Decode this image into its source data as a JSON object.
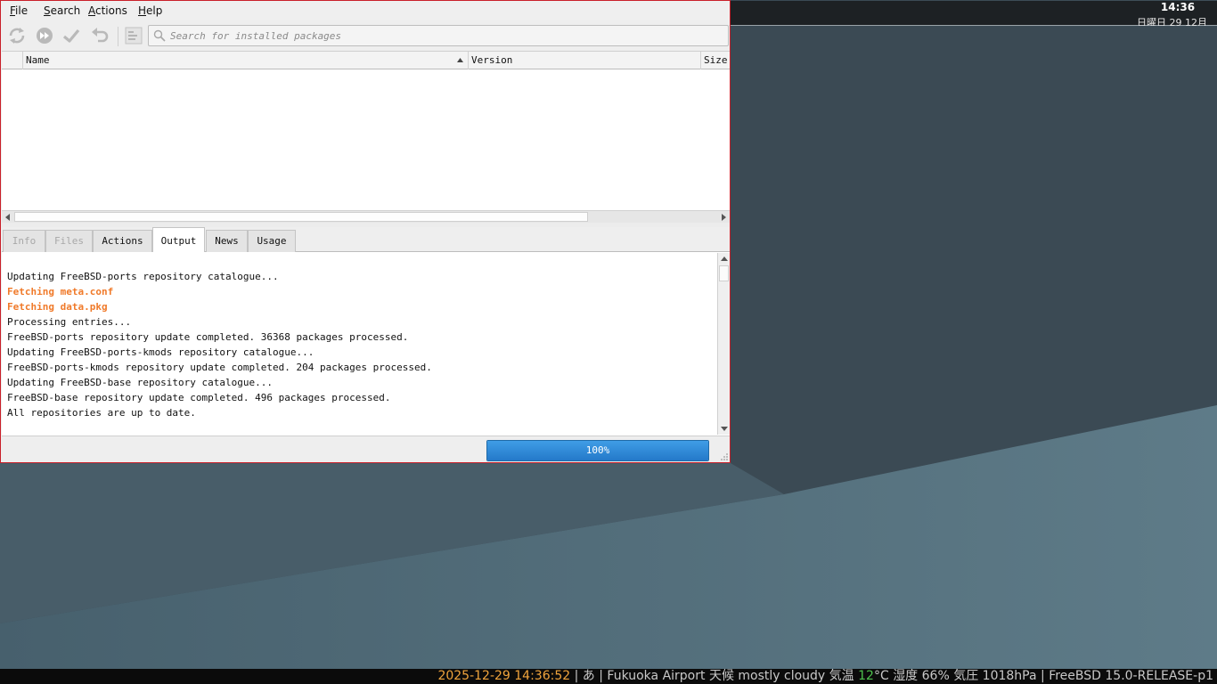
{
  "app": {
    "menu": [
      "File",
      "Search",
      "Actions",
      "Help"
    ],
    "menu_mnemonics": [
      "F",
      "S",
      "A",
      "H"
    ],
    "search": {
      "placeholder": "Search for installed packages",
      "value": ""
    },
    "toolbar_icons": [
      "refresh-icon",
      "fast-forward-icon",
      "checkmark-icon",
      "undo-icon",
      "list-icon"
    ],
    "table": {
      "columns": [
        "Name",
        "Version",
        "Size"
      ],
      "sorted_by": "Name",
      "rows": []
    },
    "tabs": [
      {
        "label": "Info",
        "state": "disabled"
      },
      {
        "label": "Files",
        "state": "disabled"
      },
      {
        "label": "Actions",
        "state": "normal"
      },
      {
        "label": "Output",
        "state": "active"
      },
      {
        "label": "News",
        "state": "normal"
      },
      {
        "label": "Usage",
        "state": "normal"
      }
    ],
    "output_lines": [
      {
        "text": "Updating FreeBSD-ports repository catalogue...",
        "highlight": false
      },
      {
        "text": "Fetching meta.conf",
        "highlight": true
      },
      {
        "text": "Fetching data.pkg",
        "highlight": true
      },
      {
        "text": "Processing entries...",
        "highlight": false
      },
      {
        "text": "FreeBSD-ports repository update completed. 36368 packages processed.",
        "highlight": false
      },
      {
        "text": "Updating FreeBSD-ports-kmods repository catalogue...",
        "highlight": false
      },
      {
        "text": "FreeBSD-ports-kmods repository update completed. 204 packages processed.",
        "highlight": false
      },
      {
        "text": "Updating FreeBSD-base repository catalogue...",
        "highlight": false
      },
      {
        "text": "FreeBSD-base repository update completed. 496 packages processed.",
        "highlight": false
      },
      {
        "text": "All repositories are up to date.",
        "highlight": false
      }
    ],
    "progress": {
      "label": "100%",
      "value": 1.0
    }
  },
  "panel": {
    "clock_time": "14:36",
    "clock_date": "日曜日 29 12月",
    "tray_icons": [
      "clipboard-icon"
    ]
  },
  "statusbar": {
    "datetime": "2025-12-29 14:36:52",
    "sep1": " | ",
    "ime": "あ",
    "sep2": " | ",
    "location": "Fukuoka Airport",
    "weather_label": "天候",
    "weather": "mostly cloudy",
    "temp_label": "気温",
    "temp_value": "12",
    "temp_unit": "°C",
    "humidity_label": "湿度",
    "humidity": "66%",
    "pressure_label": "気圧",
    "pressure": "1018hPa",
    "sep3": " | ",
    "os": "FreeBSD 15.0-RELEASE-p1"
  },
  "colors": {
    "window_border": "#c9202a",
    "output_highlight": "#f07a2a",
    "progress_fill": "#2b86d6",
    "statusbar_datetime": "#f0a43c",
    "statusbar_temp": "#4ec24e"
  }
}
